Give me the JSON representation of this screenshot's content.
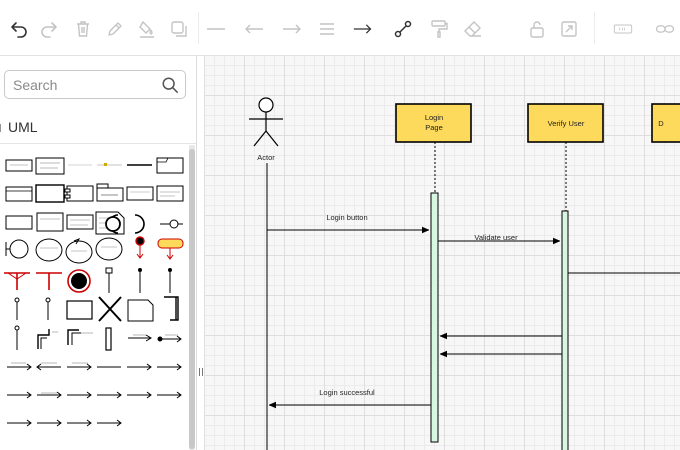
{
  "toolbar": {
    "icons": [
      "undo-icon",
      "redo-icon",
      "delete-icon",
      "edit-style-icon",
      "fill-color-icon",
      "shadow-icon",
      "line-straight-icon",
      "arrow-left-icon",
      "arrow-right-icon",
      "line-double-icon",
      "arrow-connector-icon",
      "waypoint-icon",
      "format-painter-icon",
      "eraser-icon",
      "unlock-icon",
      "fit-page-icon",
      "zoom-icon",
      "link-icon"
    ]
  },
  "sidebar": {
    "search": {
      "placeholder": "Search",
      "value": ""
    },
    "section": {
      "label": "UML"
    }
  },
  "diagram": {
    "actor": {
      "label": "Actor"
    },
    "participants": [
      {
        "id": "login",
        "label_line1": "Login",
        "label_line2": "Page"
      },
      {
        "id": "verify",
        "label_line1": "Verify User",
        "label_line2": ""
      },
      {
        "id": "third",
        "label_line1": "D",
        "label_line2": ""
      }
    ],
    "messages": [
      {
        "id": "login-button",
        "label": "Login button"
      },
      {
        "id": "validate-user",
        "label": "Validate user"
      },
      {
        "id": "login-successful",
        "label": "Login successful"
      }
    ],
    "colors": {
      "participant_fill": "#fdd95c",
      "activation_fill": "#d7f7e3",
      "line": "#000000"
    }
  }
}
